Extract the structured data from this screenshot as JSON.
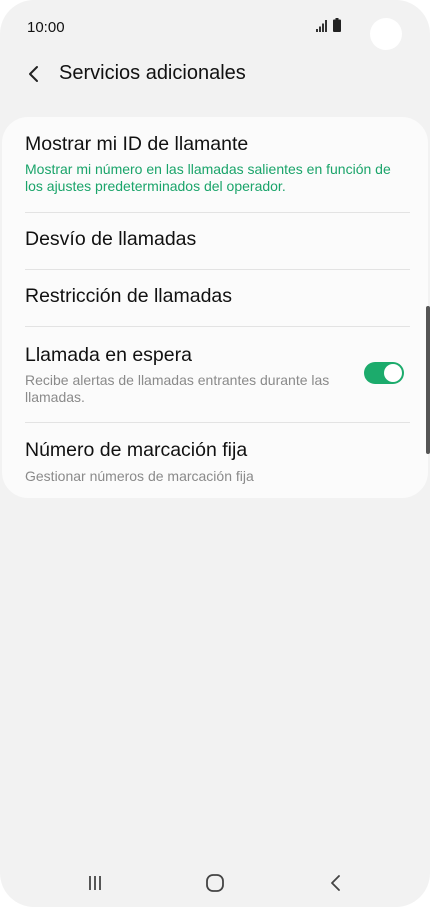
{
  "status_bar": {
    "time": "10:00",
    "icons": [
      "signal-icon",
      "battery-icon"
    ]
  },
  "header": {
    "back_icon": "chevron-left-icon",
    "title": "Servicios adicionales"
  },
  "settings": {
    "items": [
      {
        "title": "Mostrar mi ID de llamante",
        "subtitle": "Mostrar mi número en las llamadas salientes en función de los ajustes predeterminados del operador."
      },
      {
        "title": "Desvío de llamadas"
      },
      {
        "title": "Restricción de llamadas"
      },
      {
        "title": "Llamada en espera",
        "subtitle": "Recibe alertas de llamadas entrantes durante las llamadas.",
        "toggle_on": true
      },
      {
        "title": "Número de marcación fija",
        "subtitle": "Gestionar números de marcación fija"
      }
    ]
  },
  "nav_bar": {
    "buttons": [
      "recent-apps-icon",
      "home-icon",
      "back-icon"
    ]
  },
  "colors": {
    "accent": "#1aa46a",
    "toggle_on": "#1cab6c",
    "background": "#f2f2f2",
    "card": "#fbfbfb"
  }
}
